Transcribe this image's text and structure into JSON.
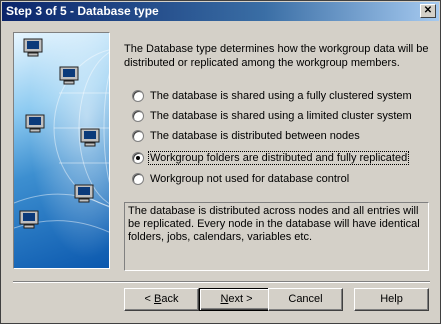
{
  "window": {
    "title": "Step 3 of 5 - Database type",
    "close_glyph": "✕"
  },
  "intro": "The Database type determines how the workgroup data will be distributed or replicated among the workgroup members.",
  "options": [
    {
      "label": "The database is shared using a fully clustered system",
      "checked": false
    },
    {
      "label": "The database is shared using a limited cluster system",
      "checked": false
    },
    {
      "label": "The database is distributed between nodes",
      "checked": false
    },
    {
      "label": "Workgroup folders are distributed and fully replicated",
      "checked": true
    },
    {
      "label": "Workgroup not used for database control",
      "checked": false
    }
  ],
  "description": "The database is distributed across nodes and all entries will be replicated. Every node in the database will have identical folders, jobs, calendars, variables etc.",
  "buttons": {
    "back": {
      "mnemonic": "B",
      "rest": "ack",
      "prefix": "< "
    },
    "next": {
      "mnemonic": "N",
      "rest": "ext",
      "suffix": " >"
    },
    "cancel": "Cancel",
    "help": "Help"
  },
  "art": {
    "icon": "computer-network-icon",
    "colors": [
      "#e8f6ff",
      "#3d8fd0",
      "#0b58ae"
    ]
  }
}
